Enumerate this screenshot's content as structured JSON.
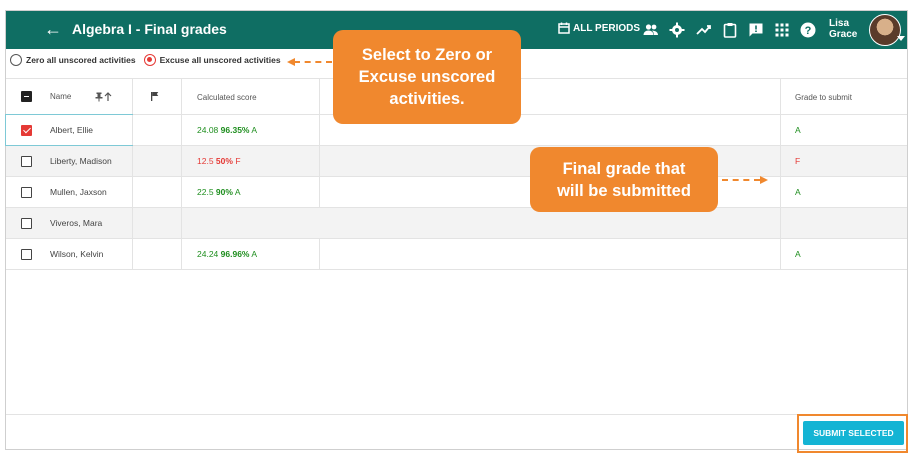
{
  "header": {
    "title": "Algebra I - Final grades",
    "periods_label": "ALL PERIODS",
    "user_first": "Lisa",
    "user_last": "Grace",
    "icons": [
      "menu-icon",
      "back-arrow-icon",
      "calendar-icon",
      "people-icon",
      "gear-icon",
      "trend-icon",
      "clipboard-icon",
      "feedback-icon",
      "grid-icon",
      "help-icon"
    ],
    "bar_color": "#0f6e63"
  },
  "options": {
    "zero_label": "Zero all unscored activities",
    "excuse_label": "Excuse all unscored activities",
    "selected": "excuse"
  },
  "table": {
    "columns": {
      "name": "Name",
      "calculated": "Calculated score",
      "grade": "Grade to submit"
    },
    "rows": [
      {
        "name": "Albert, Ellie",
        "points": "24.08",
        "percent": "96.35%",
        "letter": "A",
        "grade": "A",
        "status": "green",
        "checked": true
      },
      {
        "name": "Liberty, Madison",
        "points": "12.5",
        "percent": "50%",
        "letter": "F",
        "grade": "F",
        "status": "red",
        "checked": false
      },
      {
        "name": "Mullen, Jaxson",
        "points": "22.5",
        "percent": "90%",
        "letter": "A",
        "grade": "A",
        "status": "green",
        "checked": false
      },
      {
        "name": "Viveros, Mara",
        "points": "",
        "percent": "",
        "letter": "",
        "grade": "",
        "status": "none",
        "checked": false
      },
      {
        "name": "Wilson, Kelvin",
        "points": "24.24",
        "percent": "96.96%",
        "letter": "A",
        "grade": "A",
        "status": "green",
        "checked": false
      }
    ]
  },
  "footer": {
    "submit_label": "SUBMIT SELECTED"
  },
  "callouts": {
    "zero_excuse": [
      "Select to Zero or",
      "Excuse unscored",
      "activities."
    ],
    "final_grade": [
      "Final grade that",
      "will be submitted"
    ],
    "color": "#f0882e"
  }
}
